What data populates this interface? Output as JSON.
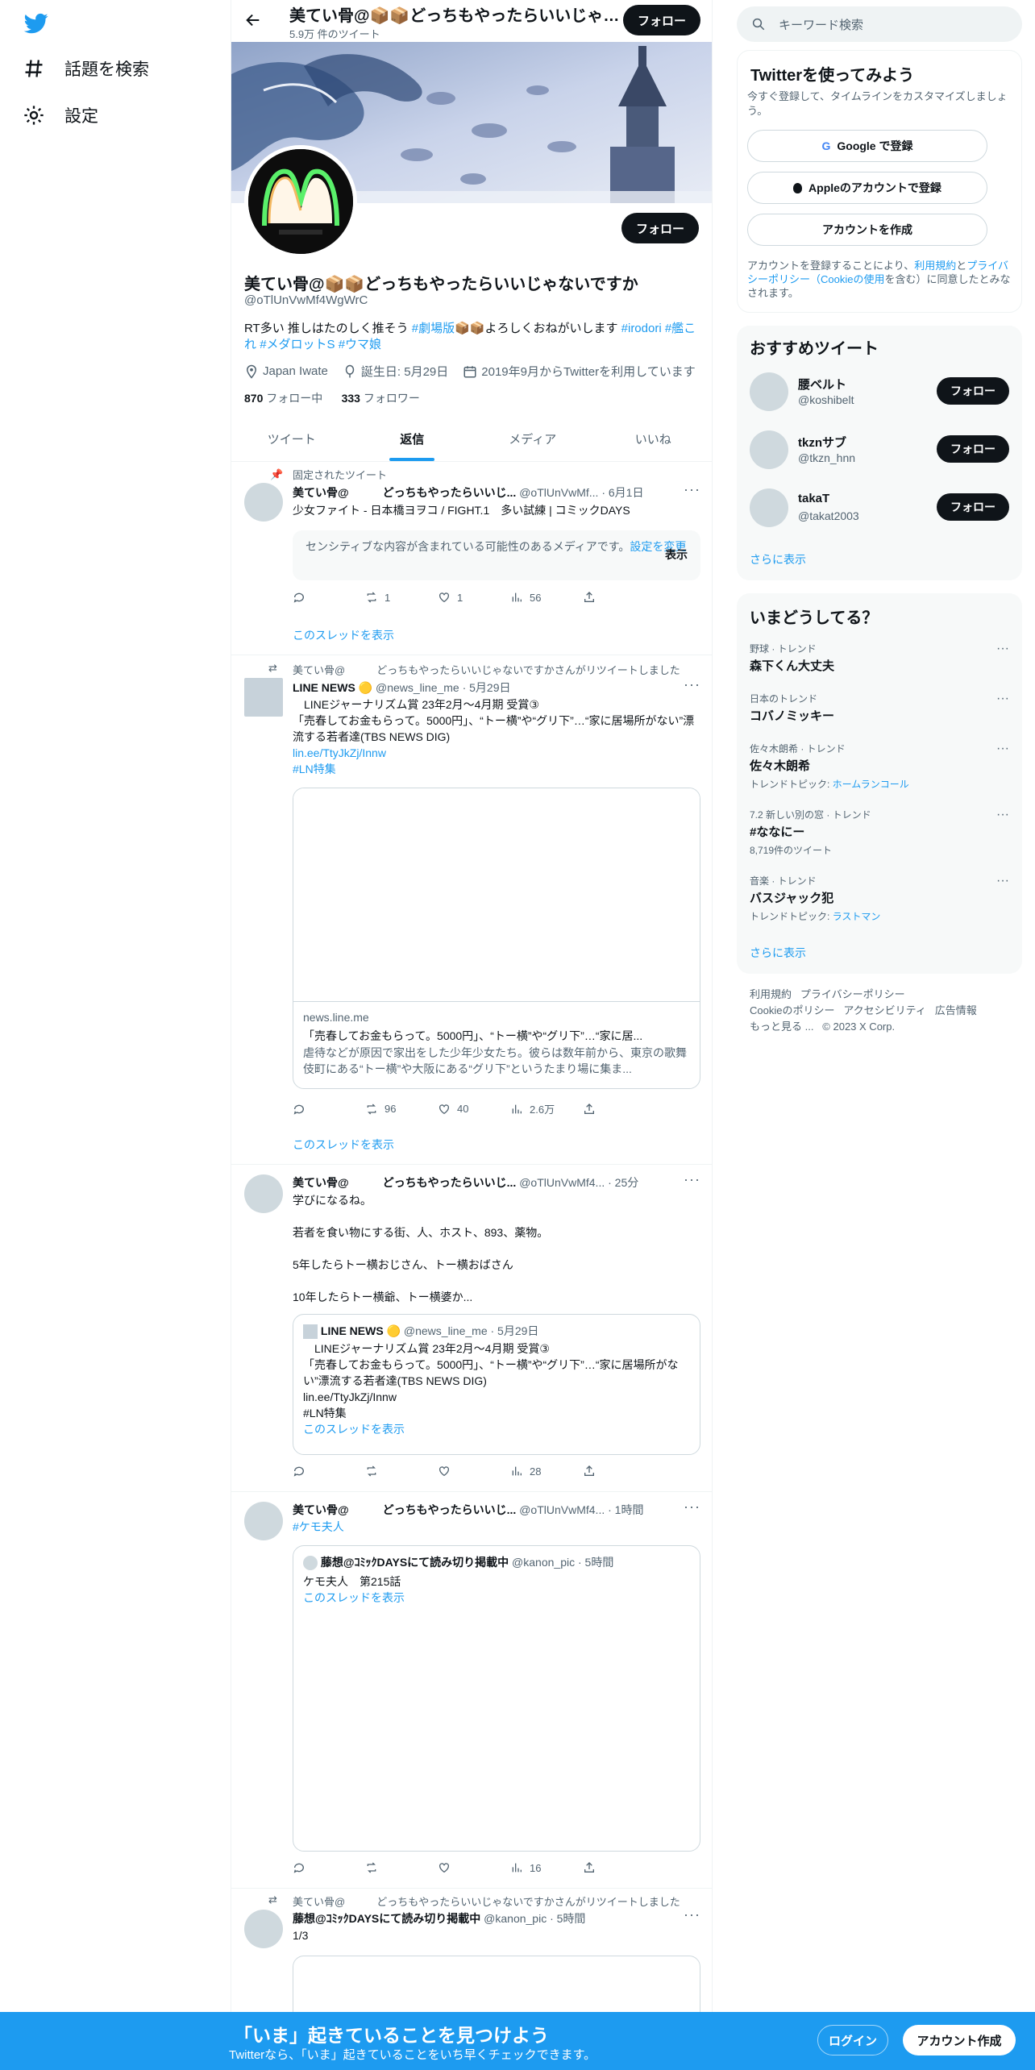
{
  "nav": {
    "explore": "話題を検索",
    "settings": "設定"
  },
  "header": {
    "title": "美てい骨@📦📦どっちもやったらいいじゃないですか",
    "tweet_count": "5.9万 件のツイート",
    "follow": "フォロー"
  },
  "profile": {
    "name": "美てい骨@📦📦どっちもやったらいいじゃないですか",
    "handle": "@oTlUnVwMf4WgWrC",
    "follow": "フォロー",
    "bio_text1": "RT多い 推しはたのしく推そう ",
    "bio_tag1": "#劇場版",
    "bio_text2": "📦📦よろしくおねがいします ",
    "bio_tag2": "#irodori",
    "bio_tag3": "#艦これ",
    "bio_tag4": "#メダロットS",
    "bio_tag5": "#ウマ娘",
    "location": "Japan Iwate",
    "birthday": "誕生日: 5月29日",
    "joined": "2019年9月からTwitterを利用しています",
    "following_count": "870",
    "following_label": "フォロー中",
    "followers_count": "333",
    "followers_label": "フォロワー"
  },
  "tabs": [
    "ツイート",
    "返信",
    "メディア",
    "いいね"
  ],
  "tweets": {
    "t1": {
      "pinned": "固定されたツイート",
      "name": "美てい骨@　　　どっちもやったらいいじ...",
      "meta": "@oTlUnVwMf... · 6月1日",
      "text": "少女ファイト - 日本橋ヨヲコ / FIGHT.1　多い試練 | コミックDAYS",
      "sensitive": "センシティブな内容が含まれている可能性のあるメディアです。",
      "sensitive_link": "設定を変更",
      "show": "表示",
      "reply": "",
      "retweets": "1",
      "likes": "1",
      "views": "56",
      "thread": "このスレッドを表示"
    },
    "t2": {
      "context": "美てい骨@　　　どっちもやったらいいじゃないですかさんがリツイートしました",
      "name": "LINE NEWS",
      "meta": "@news_line_me · 5月29日",
      "text": "　LINEジャーナリズム賞 23年2月〜4月期 受賞③\n「売春してお金もらって。5000円」、“トー横”や“グリ下”…“家に居場所がない”漂流する若者達(TBS NEWS DIG)",
      "link": "lin.ee/TtyJkZj/Innw",
      "tag": "#LN特集",
      "card_domain": "news.line.me",
      "card_title": "「売春してお金もらって。5000円」、“トー横”や“グリ下”…“家に居...",
      "card_desc": "虐待などが原因で家出をした少年少女たち。彼らは数年前から、東京の歌舞伎町にある“トー横”や大阪にある“グリ下”というたまり場に集ま...",
      "retweets": "96",
      "likes": "40",
      "views": "2.6万",
      "thread": "このスレッドを表示"
    },
    "t3": {
      "name": "美てい骨@　　　どっちもやったらいいじ...",
      "meta": "@oTlUnVwMf4... · 25分",
      "text": "学びになるね。\n\n若者を食い物にする街、人、ホスト、893、薬物。\n\n5年したらトー横おじさん、トー横おばさん\n\n10年したらトー横爺、トー横婆か...",
      "quote_name": "LINE NEWS",
      "quote_meta": "@news_line_me · 5月29日",
      "quote_text": "　LINEジャーナリズム賞 23年2月〜4月期 受賞③\n「売春してお金もらって。5000円」、“トー横”や“グリ下”…“家に居場所がない”漂流する若者達(TBS NEWS DIG)\nlin.ee/TtyJkZj/Innw\n#LN特集",
      "quote_thread": "このスレッドを表示",
      "views": "28"
    },
    "t4": {
      "name": "美てい骨@　　　どっちもやったらいいじ...",
      "meta": "@oTlUnVwMf4... · 1時間",
      "tag": "#ケモ夫人",
      "quote_name": "藤想@ｺﾐｯｸDAYSにて読み切り掲載中",
      "quote_meta": "@kanon_pic · 5時間",
      "quote_text": "ケモ夫人　第215話",
      "quote_thread": "このスレッドを表示",
      "views": "16"
    },
    "t5": {
      "context": "美てい骨@　　　どっちもやったらいいじゃないですかさんがリツイートしました",
      "name": "藤想@ｺﾐｯｸDAYSにて読み切り掲載中",
      "meta": "@kanon_pic · 5時間",
      "text": "1/3"
    }
  },
  "right": {
    "search_placeholder": "キーワード検索",
    "signup_title": "Twitterを使ってみよう",
    "signup_desc": "今すぐ登録して、タイムラインをカスタマイズしましょう。",
    "google_btn": "Google で登録",
    "apple_btn": "Appleのアカウントで登録",
    "create_btn": "アカウントを作成",
    "legal_1": "アカウントを登録することにより、",
    "legal_terms": "利用規約",
    "legal_2": "と",
    "legal_privacy": "プライバシーポリシー（Cookieの使用",
    "legal_3": "を含む）に同意したとみなされます。",
    "rec_title": "おすすめツイート",
    "recs": [
      {
        "name": "腰ベルト",
        "handle": "@koshibelt",
        "follow": "フォロー"
      },
      {
        "name": "tkznサブ",
        "handle": "@tkzn_hnn",
        "follow": "フォロー"
      },
      {
        "name": "takaT",
        "handle": "@takat2003",
        "follow": "フォロー"
      }
    ],
    "more": "さらに表示",
    "trend_title": "いまどうしてる？",
    "trends": [
      {
        "ctx": "野球 · トレンド",
        "name": "森下くん大丈夫"
      },
      {
        "ctx": "日本のトレンド",
        "name": "コバノミッキー"
      },
      {
        "ctx": "佐々木朗希 · トレンド",
        "name": "佐々木朗希",
        "sub_label": "トレンドトピック: ",
        "sub_link": "ホームランコール"
      },
      {
        "ctx": "7.2 新しい別の窓 · トレンド",
        "name": "#ななにー",
        "sub_label": "8,719件のツイート"
      },
      {
        "ctx": "音楽 · トレンド",
        "name": "バスジャック犯",
        "sub_label": "トレンドトピック: ",
        "sub_link": "ラストマン"
      }
    ],
    "trend_more": "さらに表示",
    "footer": [
      "利用規約",
      "プライバシーポリシー",
      "Cookieのポリシー",
      "アクセシビリティ",
      "広告情報",
      "もっと見る ...",
      "© 2023 X Corp."
    ]
  },
  "bottom": {
    "title": "「いま」起きていることを見つけよう",
    "sub": "Twitterなら、「いま」起きていることをいち早くチェックできます。",
    "login": "ログイン",
    "signup": "アカウント作成"
  },
  "colors": {
    "accent": "#1d9bf0",
    "dark": "#0f1419",
    "muted": "#536471"
  }
}
